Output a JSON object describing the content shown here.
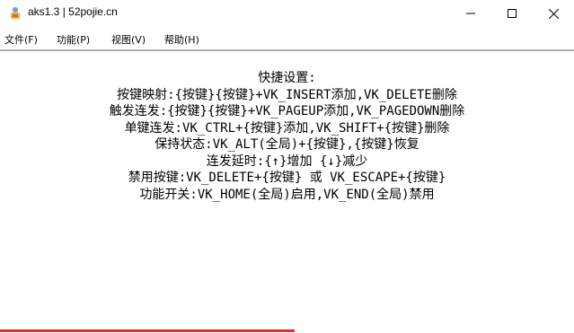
{
  "window": {
    "title": "aks1.3 | 52pojie.cn",
    "app_icon": "app-icon"
  },
  "controls": {
    "minimize_icon": "minimize-icon",
    "maximize_icon": "maximize-icon",
    "close_icon": "close-icon"
  },
  "menubar": {
    "items": [
      {
        "label": "文件(F)"
      },
      {
        "label": "功能(P)"
      },
      {
        "label": "视图(V)"
      },
      {
        "label": "帮助(H)"
      }
    ]
  },
  "content": {
    "lines": [
      "快捷设置:",
      "按键映射:{按键}{按键}+VK_INSERT添加,VK_DELETE删除",
      "触发连发:{按键}{按键}+VK_PAGEUP添加,VK_PAGEDOWN删除",
      "单键连发:VK_CTRL+{按键}添加,VK_SHIFT+{按键}删除",
      "保持状态:VK_ALT(全局)+{按键},{按键}恢复",
      "连发延时:{↑}增加 {↓}减少",
      "禁用按键:VK_DELETE+{按键} 或 VK_ESCAPE+{按键}",
      "功能开关:VK_HOME(全局)启用,VK_END(全局)禁用"
    ]
  },
  "colors": {
    "accent_bar": "#e0302a",
    "separator": "#b0b0b0",
    "background": "#ffffff",
    "text": "#000000"
  }
}
